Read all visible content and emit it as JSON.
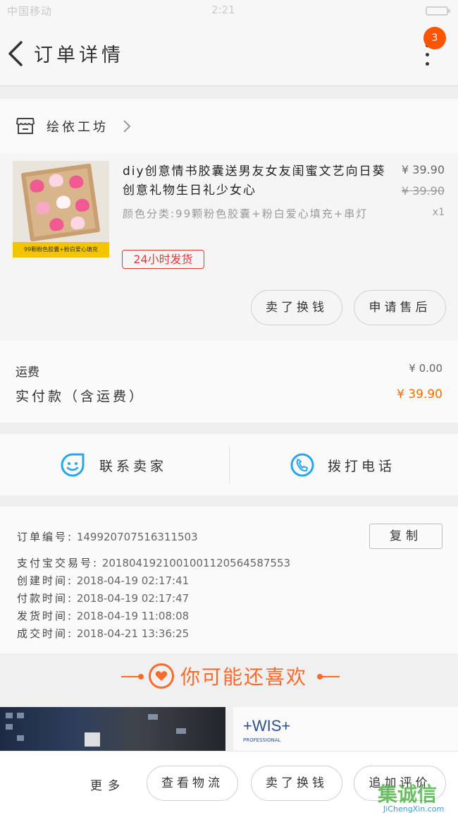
{
  "status_bar": {
    "carrier": "中国移动",
    "time": "2:21"
  },
  "nav": {
    "title": "订单详情",
    "badge": "3"
  },
  "shop": {
    "name": "绘依工坊"
  },
  "product": {
    "name": "diy创意情书胶囊送男友女友闺蜜文艺向日葵创意礼物生日礼少女心",
    "sku": "颜色分类:99颗粉色胶囊+粉白爱心填充+串灯",
    "price": "¥ 39.90",
    "original_price": "¥ 39.90",
    "quantity": "x1",
    "tag": "24小时发货",
    "image_caption": "99颗粉色胶囊+粉白爱心填充",
    "actions": [
      "卖了换钱",
      "申请售后"
    ]
  },
  "fees": {
    "shipping_label": "运费",
    "shipping_value": "¥ 0.00",
    "paid_label": "实付款（含运费）",
    "paid_value": "¥ 39.90"
  },
  "contact": {
    "seller_label": "联系卖家",
    "call_label": "拨打电话"
  },
  "order_info": {
    "copy_label": "复制",
    "rows": [
      {
        "label": "订单编号:",
        "value": "149920707516311503"
      },
      {
        "label": "支付宝交易号:",
        "value": "2018041921001001120564587553"
      },
      {
        "label": "创建时间:",
        "value": "2018-04-19 02:17:41"
      },
      {
        "label": "付款时间:",
        "value": "2018-04-19 02:17:47"
      },
      {
        "label": "发货时间:",
        "value": "2018-04-19 11:08:08"
      },
      {
        "label": "成交时间:",
        "value": "2018-04-21 13:36:25"
      }
    ]
  },
  "recommend": {
    "title": "你可能还喜欢",
    "brand": "+WIS+",
    "brand_sub": "PROFESSIONAL"
  },
  "bottom_bar": {
    "more": "更多",
    "buttons": [
      "查看物流",
      "卖了换钱",
      "追加评价"
    ]
  },
  "watermark": {
    "cn": "集诚信",
    "en": "JiChengXin.com"
  },
  "colors": {
    "accent": "#ff6a00",
    "tag_red": "#e4393c",
    "contact_blue": "#29a6e8"
  },
  "icons": [
    "back-arrow-icon",
    "more-dots-icon",
    "shop-icon",
    "chevron-right-icon",
    "smiley-chat-icon",
    "phone-icon",
    "heart-circle-icon"
  ]
}
